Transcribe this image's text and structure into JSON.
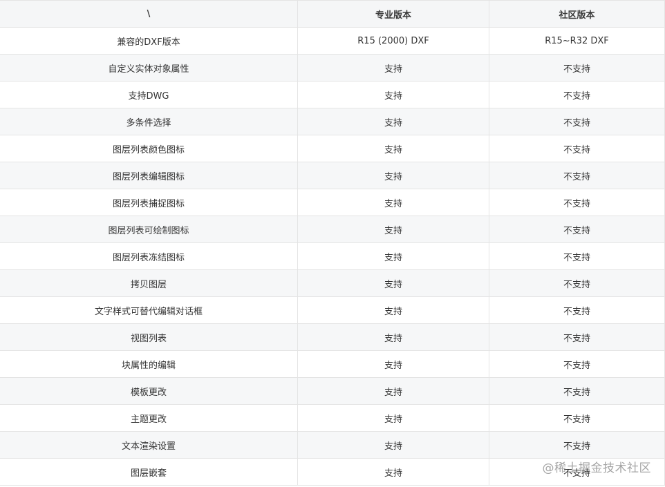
{
  "headers": [
    "\\",
    "专业版本",
    "社区版本"
  ],
  "rows": [
    [
      "兼容的DXF版本",
      "R15 (2000) DXF",
      "R15~R32 DXF"
    ],
    [
      "自定义实体对象属性",
      "支持",
      "不支持"
    ],
    [
      "支持DWG",
      "支持",
      "不支持"
    ],
    [
      "多条件选择",
      "支持",
      "不支持"
    ],
    [
      "图层列表颜色图标",
      "支持",
      "不支持"
    ],
    [
      "图层列表编辑图标",
      "支持",
      "不支持"
    ],
    [
      "图层列表捕捉图标",
      "支持",
      "不支持"
    ],
    [
      "图层列表可绘制图标",
      "支持",
      "不支持"
    ],
    [
      "图层列表冻结图标",
      "支持",
      "不支持"
    ],
    [
      "拷贝图层",
      "支持",
      "不支持"
    ],
    [
      "文字样式可替代编辑对话框",
      "支持",
      "不支持"
    ],
    [
      "视图列表",
      "支持",
      "不支持"
    ],
    [
      "块属性的编辑",
      "支持",
      "不支持"
    ],
    [
      "模板更改",
      "支持",
      "不支持"
    ],
    [
      "主题更改",
      "支持",
      "不支持"
    ],
    [
      "文本渲染设置",
      "支持",
      "不支持"
    ],
    [
      "图层嵌套",
      "支持",
      "不支持"
    ]
  ],
  "watermark": "@稀土掘金技术社区"
}
